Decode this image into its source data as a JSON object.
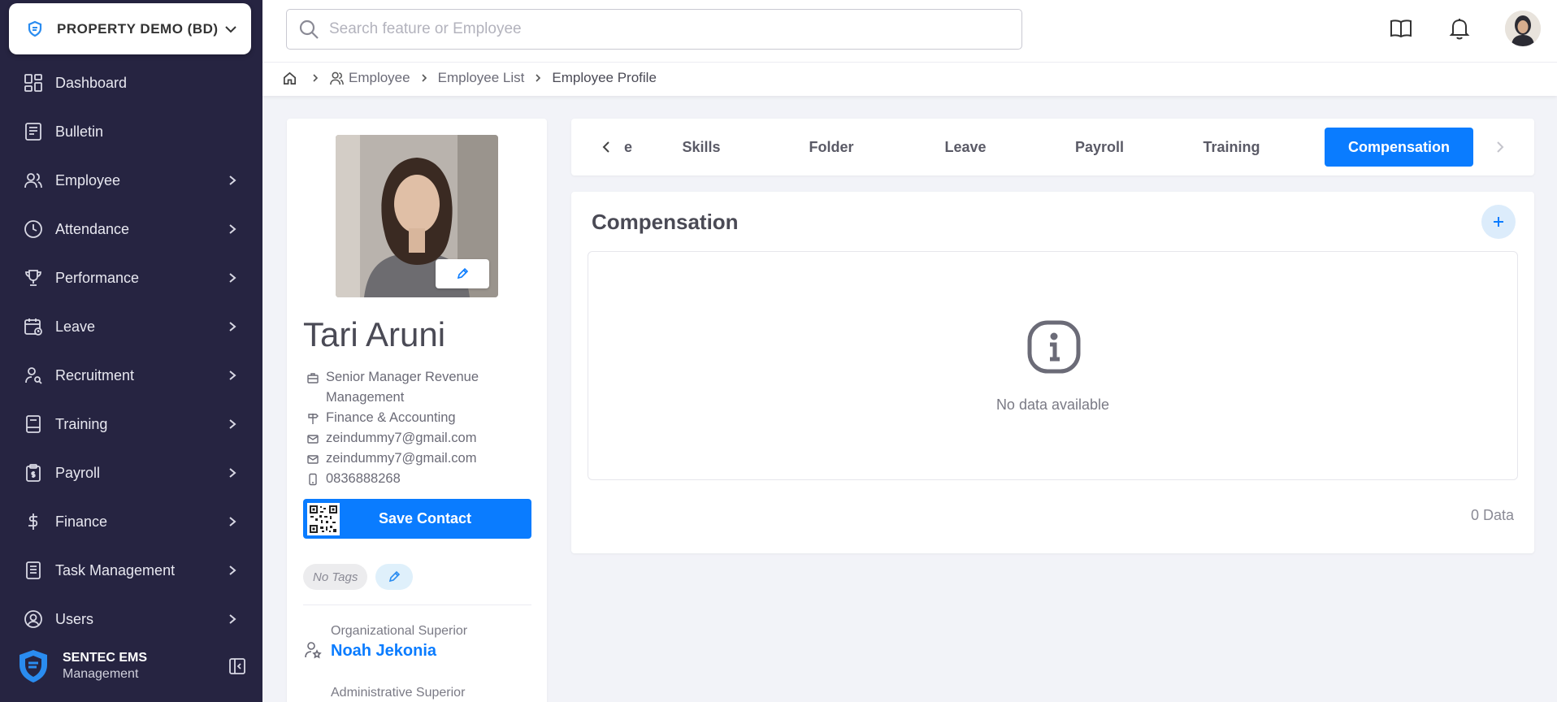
{
  "company": {
    "name": "PROPERTY DEMO (BD)"
  },
  "sidebar": {
    "items": [
      {
        "label": "Dashboard",
        "icon": "dashboard-icon",
        "arrow": false
      },
      {
        "label": "Bulletin",
        "icon": "bulletin-icon",
        "arrow": false
      },
      {
        "label": "Employee",
        "icon": "users-icon",
        "arrow": true
      },
      {
        "label": "Attendance",
        "icon": "clock-icon",
        "arrow": true
      },
      {
        "label": "Performance",
        "icon": "trophy-icon",
        "arrow": true
      },
      {
        "label": "Leave",
        "icon": "calendar-icon",
        "arrow": true
      },
      {
        "label": "Recruitment",
        "icon": "user-search-icon",
        "arrow": true
      },
      {
        "label": "Training",
        "icon": "book-icon",
        "arrow": true
      },
      {
        "label": "Payroll",
        "icon": "clipboard-icon",
        "arrow": true
      },
      {
        "label": "Finance",
        "icon": "dollar-icon",
        "arrow": true
      },
      {
        "label": "Task Management",
        "icon": "task-icon",
        "arrow": true
      },
      {
        "label": "Users",
        "icon": "user-circle-icon",
        "arrow": true
      }
    ]
  },
  "brand": {
    "title": "SENTEC EMS",
    "subtitle": "Management"
  },
  "search": {
    "placeholder": "Search feature or Employee"
  },
  "breadcrumb": {
    "items": [
      "Employee",
      "Employee List",
      "Employee Profile"
    ]
  },
  "profile": {
    "name": "Tari Aruni",
    "position": "Senior Manager Revenue Management",
    "department": "Finance & Accounting",
    "email1": "zeindummy7@gmail.com",
    "email2": "zeindummy7@gmail.com",
    "phone": "0836888268",
    "save_contact": "Save Contact",
    "tag": "No Tags",
    "org_superior_label": "Organizational Superior",
    "org_superior_name": "Noah Jekonia",
    "admin_superior_label": "Administrative Superior"
  },
  "tabs": {
    "items": [
      "e",
      "Skills",
      "Folder",
      "Leave",
      "Payroll",
      "Training",
      "Compensation"
    ],
    "active": "Compensation"
  },
  "panel": {
    "title": "Compensation",
    "empty_text": "No data available",
    "count": "0 Data"
  },
  "colors": {
    "sidebar": "#262441",
    "accent": "#0a7cff"
  }
}
